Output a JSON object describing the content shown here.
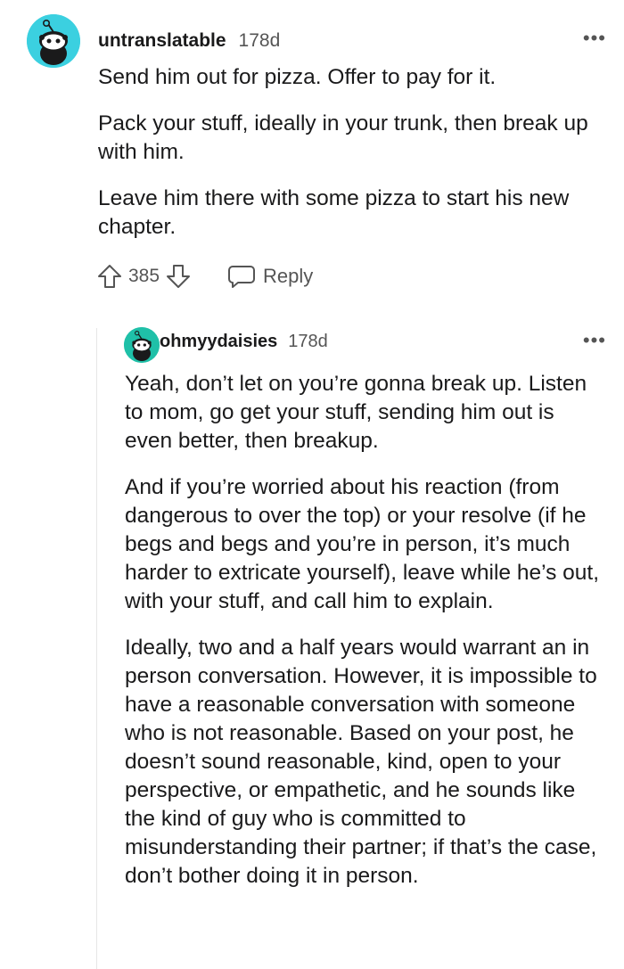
{
  "comments": [
    {
      "username": "untranslatable",
      "timestamp": "178d",
      "avatar_icon": "snoo-avatar-icon",
      "avatar_color": "#3bd0e0",
      "paragraphs": [
        "Send him out for pizza. Offer to pay for it.",
        "Pack your stuff, ideally in your trunk, then break up with him.",
        "Leave him there with some pizza to start his new chapter."
      ],
      "score": "385",
      "reply_label": "Reply"
    },
    {
      "username": "ohmyydaisies",
      "timestamp": "178d",
      "avatar_icon": "snoo-avatar-icon",
      "avatar_color": "#1fc0a8",
      "paragraphs": [
        "Yeah, don’t let on you’re gonna break up. Listen to mom, go get your stuff, sending him out is even better, then breakup.",
        "And if you’re worried about his reaction (from dangerous to over the top) or your resolve (if he begs and begs and you’re in person, it’s much harder to extricate yourself), leave while he’s out, with your stuff, and call him to explain.",
        "Ideally, two and a half years would warrant an in person conversation. However, it is impossible to have a reasonable conversation with someone who is not reasonable. Based on your post, he doesn’t sound reasonable, kind, open to your perspective, or empathetic, and he sounds like the kind of guy who is committed to misunderstanding their partner; if that’s the case, don’t bother doing it in person."
      ]
    }
  ],
  "icons": {
    "more": "more-options-icon",
    "upvote": "upvote-arrow-icon",
    "downvote": "downvote-arrow-icon",
    "reply": "comment-bubble-icon"
  }
}
